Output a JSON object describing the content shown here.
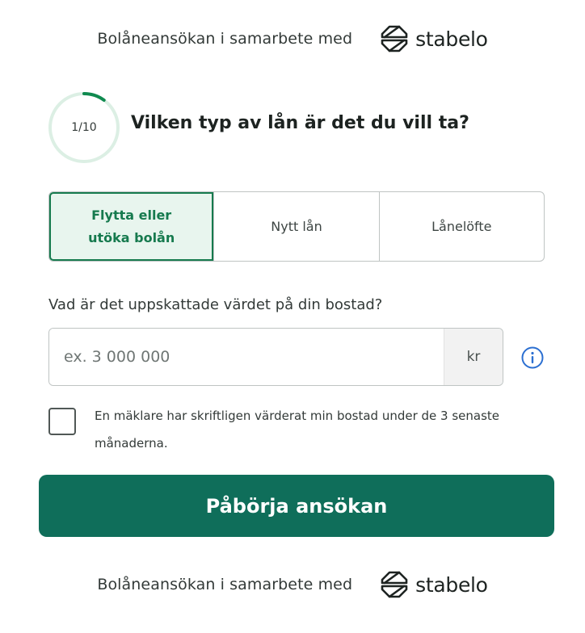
{
  "partner_top": {
    "text": "Bolåneansökan i samarbete med",
    "brand": "stabelo"
  },
  "progress": {
    "step_label": "1/10",
    "fraction": 0.1,
    "track_color": "#dcefe4",
    "fill_color": "#0f8a4f"
  },
  "question": "Vilken typ av lån är det du vill ta?",
  "loan_types": [
    {
      "label": "Flytta eller\nutöka bolån",
      "selected": true
    },
    {
      "label": "Nytt lån",
      "selected": false
    },
    {
      "label": "Lånelöfte",
      "selected": false
    }
  ],
  "value_field": {
    "label": "Vad är det uppskattade värdet på din bostad?",
    "placeholder": "ex. 3 000 000",
    "value": "",
    "unit": "kr",
    "info_icon": "info-icon"
  },
  "valuation_checkbox": {
    "checked": false,
    "label": "En mäklare har skriftligen värderat min bostad under de 3 senaste månaderna."
  },
  "cta": {
    "label": "Påbörja ansökan",
    "color": "#0f6e5a"
  },
  "partner_bottom": {
    "text": "Bolåneansökan i samarbete med",
    "brand": "stabelo"
  },
  "colors": {
    "accent": "#167a4e",
    "selected_bg": "#e8f5ee",
    "info_blue": "#2b6fd1"
  }
}
